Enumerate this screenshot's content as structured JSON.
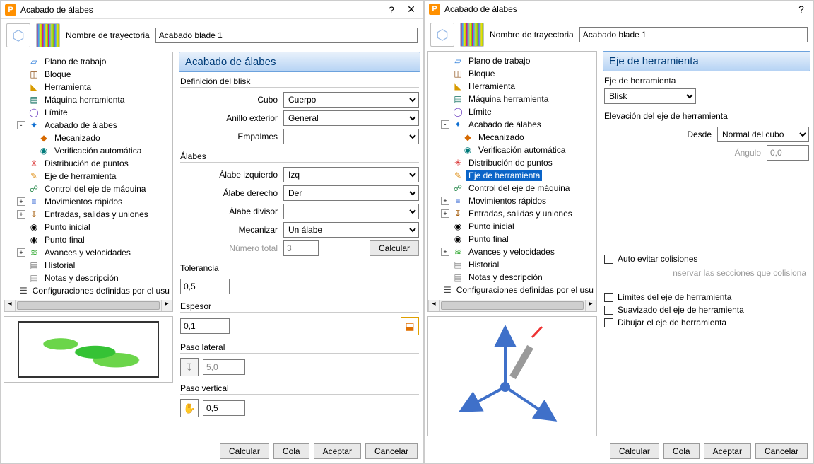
{
  "app": {
    "icon_letter": "P"
  },
  "left": {
    "title": "Acabado de álabes",
    "trajectory_label": "Nombre de trayectoria",
    "trajectory_value": "Acabado blade 1",
    "pane_head": "Acabado de álabes",
    "group_blisk": "Definición del blisk",
    "blisk": {
      "cubo_label": "Cubo",
      "cubo_value": "Cuerpo",
      "anillo_label": "Anillo exterior",
      "anillo_value": "General",
      "empalmes_label": "Empalmes",
      "empalmes_value": ""
    },
    "group_alabes": "Álabes",
    "alabes": {
      "izq_label": "Álabe izquierdo",
      "izq_value": "Izq",
      "der_label": "Álabe derecho",
      "der_value": "Der",
      "div_label": "Álabe divisor",
      "div_value": "",
      "mec_label": "Mecanizar",
      "mec_value": "Un álabe",
      "num_label": "Número total",
      "num_value": "3",
      "calc_btn": "Calcular"
    },
    "tol_label": "Tolerancia",
    "tol_value": "0,5",
    "esp_label": "Espesor",
    "esp_value": "0,1",
    "paso_lat_label": "Paso lateral",
    "paso_lat_value": "5,0",
    "paso_vert_label": "Paso vertical",
    "paso_vert_value": "0,5"
  },
  "right": {
    "title": "Acabado de álabes",
    "trajectory_label": "Nombre de trayectoria",
    "trajectory_value": "Acabado blade 1",
    "pane_head": "Eje de herramienta",
    "eje_label": "Eje de herramienta",
    "eje_value": "Blisk",
    "elev_label": "Elevación del eje de herramienta",
    "desde_label": "Desde",
    "desde_value": "Normal del cubo",
    "ang_label": "Ángulo",
    "ang_value": "0,0",
    "checks": {
      "auto": "Auto evitar colisiones",
      "cons": "nservar las secciones que colisiona",
      "lim": "Límites del eje de herramienta",
      "suav": "Suavizado del eje de herramienta",
      "dib": "Dibujar el eje de herramienta"
    }
  },
  "tree": [
    {
      "id": "plano",
      "label": "Plano de trabajo",
      "ic": "ic-plane",
      "glyph": "▱"
    },
    {
      "id": "bloque",
      "label": "Bloque",
      "ic": "ic-block",
      "glyph": "◫"
    },
    {
      "id": "herr",
      "label": "Herramienta",
      "ic": "ic-tool",
      "glyph": "◣"
    },
    {
      "id": "maq",
      "label": "Máquina herramienta",
      "ic": "ic-mach",
      "glyph": "▤"
    },
    {
      "id": "lim",
      "label": "Límite",
      "ic": "ic-lim",
      "glyph": "◯"
    },
    {
      "id": "strat",
      "label": "Acabado de álabes",
      "ic": "ic-strat",
      "glyph": "✦",
      "expand": true,
      "children": [
        {
          "id": "mec",
          "label": "Mecanizado",
          "ic": "ic-mec",
          "glyph": "◆"
        },
        {
          "id": "ver",
          "label": "Verificación automática",
          "ic": "ic-ver",
          "glyph": "◉"
        }
      ]
    },
    {
      "id": "dist",
      "label": "Distribución de puntos",
      "ic": "ic-dist",
      "glyph": "✳"
    },
    {
      "id": "eje",
      "label": "Eje de herramienta",
      "ic": "ic-eje",
      "glyph": "✎"
    },
    {
      "id": "ctrl",
      "label": "Control del eje de máquina",
      "ic": "ic-ctrl",
      "glyph": "☍"
    },
    {
      "id": "mov",
      "label": "Movimientos rápidos",
      "ic": "ic-mov",
      "glyph": "≡",
      "exp": "+"
    },
    {
      "id": "ent",
      "label": "Entradas, salidas y uniones",
      "ic": "ic-ent",
      "glyph": "↧",
      "exp": "+"
    },
    {
      "id": "pini",
      "label": "Punto inicial",
      "ic": "ic-pini",
      "glyph": "◉"
    },
    {
      "id": "pfin",
      "label": "Punto final",
      "ic": "ic-pfin",
      "glyph": "◉"
    },
    {
      "id": "av",
      "label": "Avances y velocidades",
      "ic": "ic-av",
      "glyph": "≋",
      "exp": "+"
    },
    {
      "id": "hist",
      "label": "Historial",
      "ic": "ic-hist",
      "glyph": "▤"
    },
    {
      "id": "note",
      "label": "Notas y descripción",
      "ic": "ic-note",
      "glyph": "▤"
    },
    {
      "id": "conf",
      "label": "Configuraciones definidas por el usu",
      "ic": "ic-conf",
      "glyph": "☰"
    }
  ],
  "buttons": {
    "calcular": "Calcular",
    "cola": "Cola",
    "aceptar": "Aceptar",
    "cancelar": "Cancelar"
  }
}
